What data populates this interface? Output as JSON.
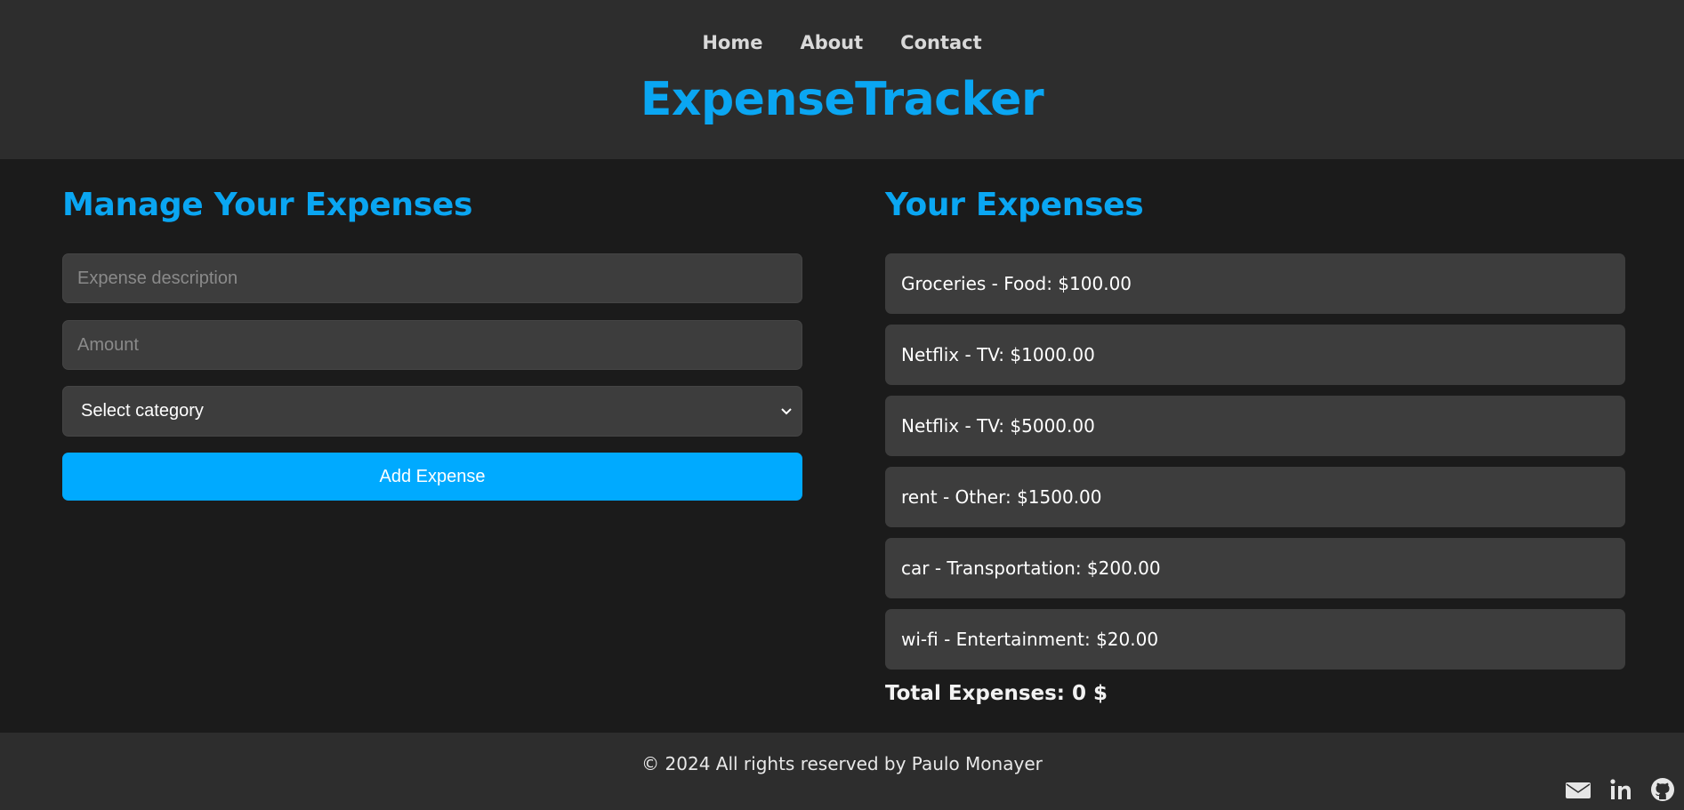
{
  "nav": {
    "items": [
      "Home",
      "About",
      "Contact"
    ]
  },
  "brand": "ExpenseTracker",
  "manage": {
    "title": "Manage Your Expenses",
    "description_placeholder": "Expense description",
    "amount_placeholder": "Amount",
    "category_selected": "Select category",
    "add_label": "Add Expense"
  },
  "expenses": {
    "title": "Your Expenses",
    "items": [
      "Groceries - Food: $100.00",
      "Netflix - TV: $1000.00",
      "Netflix - TV: $5000.00",
      "rent - Other: $1500.00",
      "car - Transportation: $200.00",
      "wi-fi - Entertainment: $20.00"
    ],
    "total": "Total Expenses: 0 $"
  },
  "footer": {
    "copyright": "© 2024 All rights reserved by Paulo Monayer",
    "social_icons": [
      "mail-icon",
      "linkedin-icon",
      "github-icon"
    ]
  },
  "colors": {
    "accent": "#00aaff",
    "header_bg": "#2d2d2d",
    "body_bg": "#1b1b1b",
    "field_bg": "#3d3d3d"
  }
}
